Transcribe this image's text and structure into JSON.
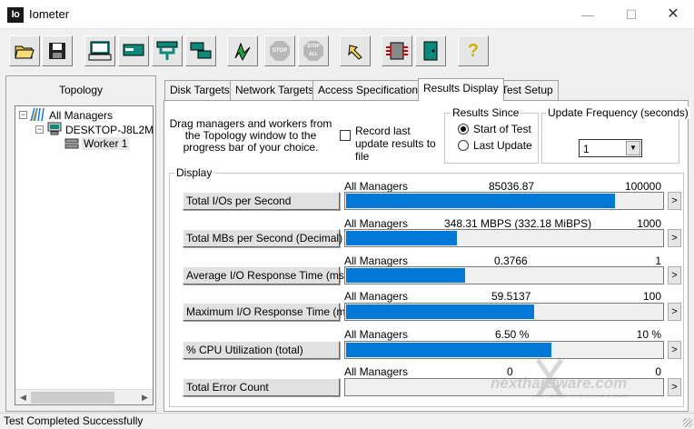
{
  "window": {
    "title": "Iometer",
    "icon_text": "Io"
  },
  "toolbar": {
    "buttons": [
      {
        "name": "open-icon"
      },
      {
        "name": "save-icon"
      },
      {
        "name": "new-disk-worker-icon"
      },
      {
        "name": "new-network-worker-icon"
      },
      {
        "name": "new-manager-icon"
      },
      {
        "name": "duplicate-worker-icon"
      },
      {
        "name": "start-icon"
      },
      {
        "name": "stop-icon",
        "label": "STOP"
      },
      {
        "name": "stop-all-icon",
        "label": "STOP ALL"
      },
      {
        "name": "reset-workers-icon"
      },
      {
        "name": "exit-icon"
      },
      {
        "name": "exit-door-icon"
      },
      {
        "name": "help-icon",
        "label": "?"
      }
    ]
  },
  "topology": {
    "title": "Topology",
    "nodes": [
      {
        "label": "All Managers"
      },
      {
        "label": "DESKTOP-J8L2M"
      },
      {
        "label": "Worker 1"
      }
    ]
  },
  "tabs": [
    {
      "label": "Disk Targets"
    },
    {
      "label": "Network Targets"
    },
    {
      "label": "Access Specifications"
    },
    {
      "label": "Results Display",
      "active": true
    },
    {
      "label": "Test Setup"
    }
  ],
  "results": {
    "drag_text": "Drag managers and workers from the Topology window to the progress bar of your choice.",
    "record_label": "Record last update results to file",
    "results_since": {
      "title": "Results Since",
      "options": [
        "Start of Test",
        "Last Update"
      ],
      "selected": "Start of Test"
    },
    "update_frequency": {
      "title": "Update Frequency (seconds)",
      "value": "1"
    },
    "display_title": "Display",
    "metrics": [
      {
        "button": "Total I/Os per Second",
        "target": "All Managers",
        "value": "85036.87",
        "max": "100000",
        "fraction": 0.85
      },
      {
        "button": "Total MBs per Second (Decimal)",
        "target": "All Managers",
        "value": "348.31 MBPS (332.18 MiBPS)",
        "max": "1000",
        "fraction": 0.35
      },
      {
        "button": "Average I/O Response Time (ms)",
        "target": "All Managers",
        "value": "0.3766",
        "max": "1",
        "fraction": 0.377
      },
      {
        "button": "Maximum I/O Response Time (ms)",
        "target": "All Managers",
        "value": "59.5137",
        "max": "100",
        "fraction": 0.595
      },
      {
        "button": "% CPU Utilization (total)",
        "target": "All Managers",
        "value": "6.50 %",
        "max": "10 %",
        "fraction": 0.65
      },
      {
        "button": "Total Error Count",
        "target": "All Managers",
        "value": "0",
        "max": "0",
        "fraction": 0
      }
    ]
  },
  "status": {
    "text": "Test Completed Successfully"
  },
  "watermark": {
    "text": "nexthardware.com",
    "tagline": "your ultimate professional resource"
  },
  "colors": {
    "bar_fill": "#0078d7",
    "panel_bg": "#f0f0f0"
  }
}
